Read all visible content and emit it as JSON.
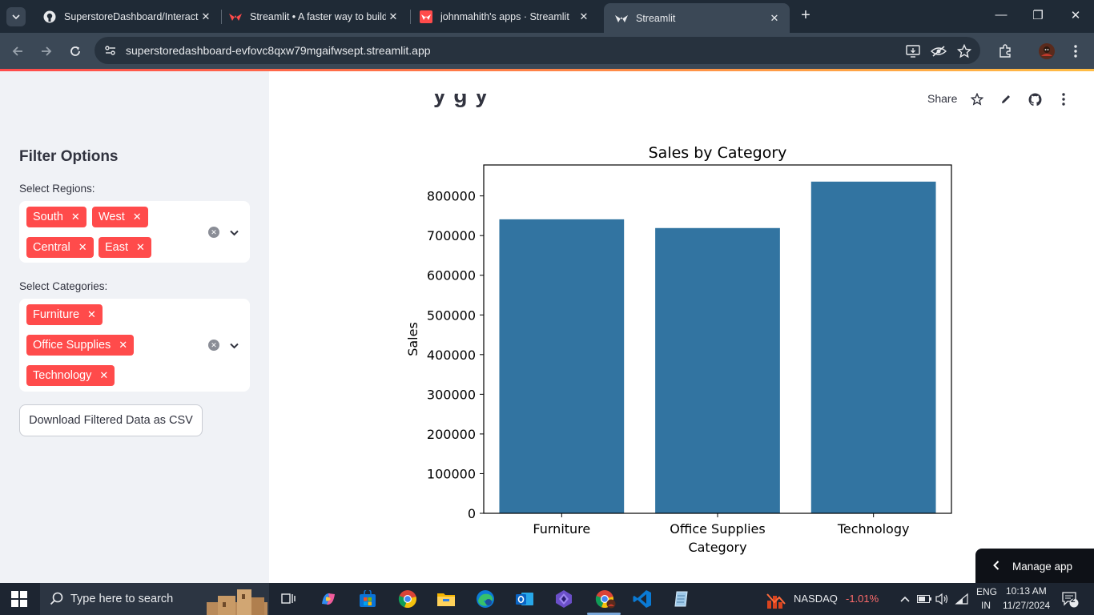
{
  "browser": {
    "tabs": [
      {
        "title": "SuperstoreDashboard/Interactive",
        "favicon": "github-icon"
      },
      {
        "title": "Streamlit • A faster way to build",
        "favicon": "streamlit-icon"
      },
      {
        "title": "johnmahith's apps · Streamlit",
        "favicon": "streamlit-icon"
      },
      {
        "title": "Streamlit",
        "favicon": "streamlit-icon",
        "active": true
      }
    ],
    "url": "superstoredashboard-evfovc8qxw79mgaifwsept.streamlit.app"
  },
  "header": {
    "share_label": "Share",
    "heading_fragment": "y    g   y"
  },
  "sidebar": {
    "title": "Filter Options",
    "regions_label": "Select Regions:",
    "regions": [
      "South",
      "West",
      "Central",
      "East"
    ],
    "categories_label": "Select Categories:",
    "categories": [
      "Furniture",
      "Office Supplies",
      "Technology"
    ],
    "download_label": "Download Filtered Data as CSV"
  },
  "chart_data": {
    "type": "bar",
    "title": "Sales by Category",
    "xlabel": "Category",
    "ylabel": "Sales",
    "categories": [
      "Furniture",
      "Office Supplies",
      "Technology"
    ],
    "values": [
      741000,
      719000,
      836000
    ],
    "yticks": [
      "0",
      "100000",
      "200000",
      "300000",
      "400000",
      "500000",
      "600000",
      "700000",
      "800000"
    ],
    "ylim": [
      0,
      878000
    ],
    "bar_color": "#3274a1",
    "grid": false
  },
  "manage_app": {
    "label": "Manage app"
  },
  "taskbar": {
    "search_placeholder": "Type here to search",
    "ticker_name": "NASDAQ",
    "ticker_change": "-1.01%",
    "lang_top": "ENG",
    "lang_bottom": "IN",
    "time": "10:13 AM",
    "date": "11/27/2024",
    "notifications": "2"
  },
  "colors": {
    "streamlit_red": "#ff4b4b",
    "sidebar_bg": "#f0f2f6",
    "chrome_dark": "#1f2a36",
    "ticker_negative": "#ff6b6b"
  }
}
